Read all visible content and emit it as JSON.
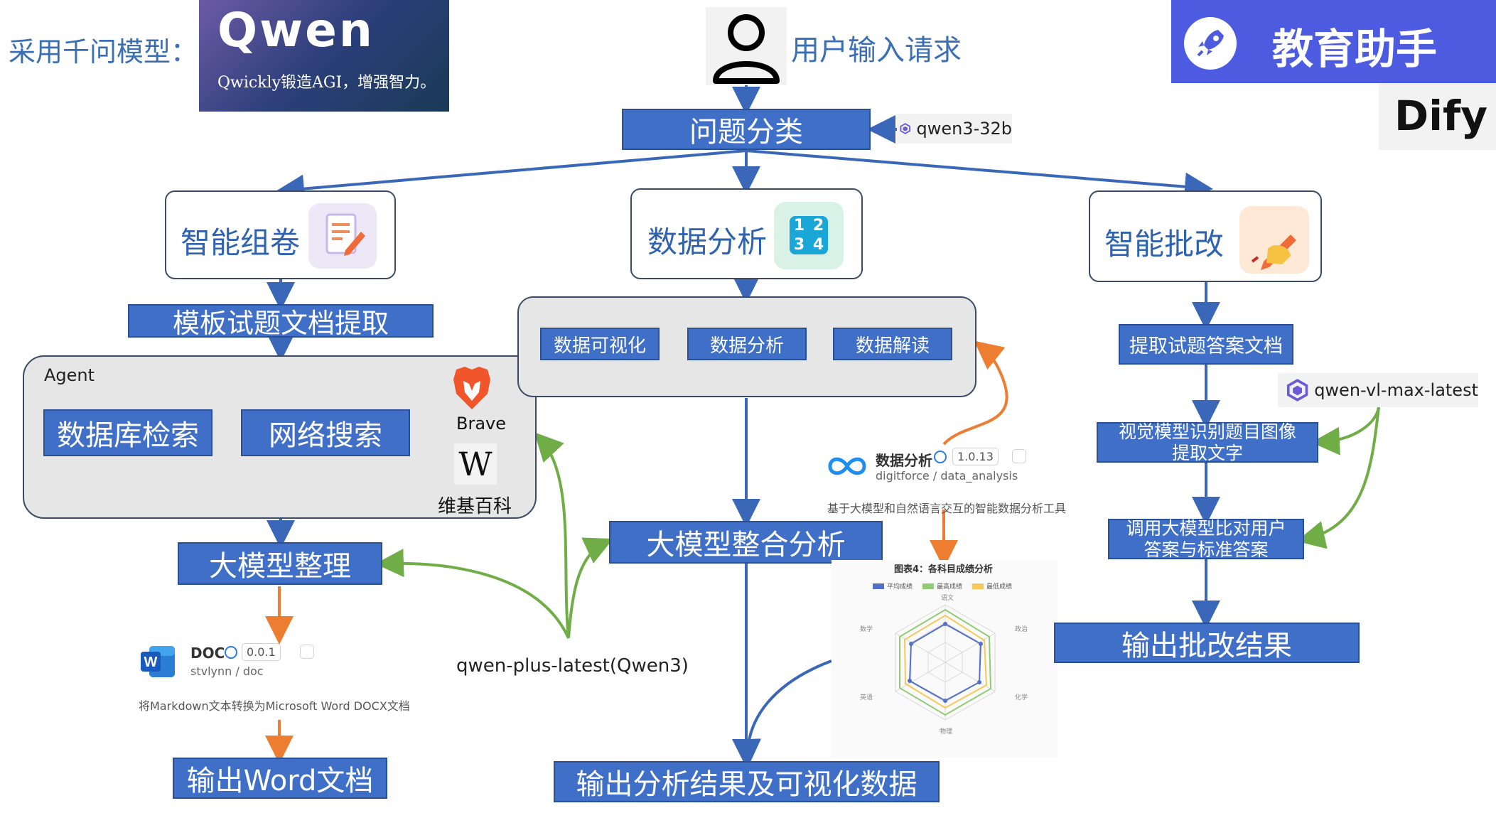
{
  "header": {
    "model_label": "采用千问模型：",
    "qwen_logo_text": "Qwen",
    "qwen_slogan": "Qwickly锻造AGI，增强智力。",
    "user_input": "用户输入请求",
    "app_name": "教育助手",
    "dify_logo_text": "Dify"
  },
  "classifier": {
    "label": "问题分类",
    "model": "qwen3-32b"
  },
  "branches": {
    "exam": {
      "title": "智能组卷",
      "extract": "模板试题文档提取",
      "agent_label": "Agent",
      "db_search": "数据库检索",
      "web_search": "网络搜索",
      "brave_label": "Brave",
      "wiki_label": "维基百科",
      "wiki_glyph": "W",
      "organize": "大模型整理",
      "plugin": {
        "name": "DOC",
        "version": "0.0.1",
        "author": "stvlynn / doc",
        "desc": "将Markdown文本转换为Microsoft Word DOCX文档"
      },
      "output": "输出Word文档"
    },
    "analysis": {
      "title": "数据分析",
      "icon_digits": [
        "1",
        "2",
        "3",
        "4"
      ],
      "tools": [
        "数据可视化",
        "数据分析",
        "数据解读"
      ],
      "plugin": {
        "name": "数据分析",
        "version": "1.0.13",
        "author": "digitforce / data_analysis",
        "desc": "基于大模型和自然语言交互的智能数据分析工具"
      },
      "integrate": "大模型整合分析",
      "output": "输出分析结果及可视化数据",
      "radar_chart": {
        "title": "图表4：各科目成绩分析",
        "legend": [
          "平均成绩",
          "最高成绩",
          "最低成绩"
        ],
        "axes": [
          "语文",
          "数学",
          "英语",
          "物理",
          "化学",
          "政治"
        ],
        "colors": [
          "#5470c6",
          "#91cc75",
          "#fac858"
        ]
      }
    },
    "grading": {
      "title": "智能批改",
      "extract": "提取试题答案文档",
      "vision_line1": "视觉模型识别题目图像",
      "vision_line2": "提取文字",
      "compare_line1": "调用大模型比对用户",
      "compare_line2": "答案与标准答案",
      "output": "输出批改结果",
      "model": "qwen-vl-max-latest"
    }
  },
  "shared_model": "qwen-plus-latest(Qwen3)",
  "colors": {
    "box_blue": "#3f6fc6",
    "arrow_blue": "#3a67b8",
    "arrow_orange": "#ed7d31",
    "arrow_green": "#70ad47",
    "banner_purple": "#4c5be0"
  }
}
